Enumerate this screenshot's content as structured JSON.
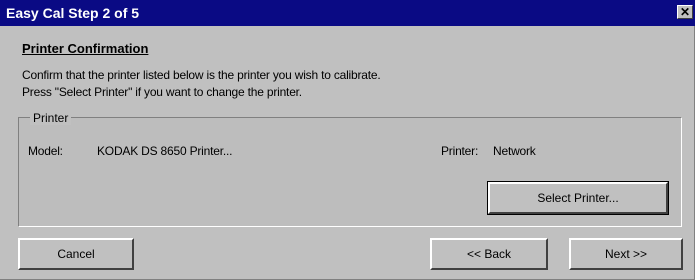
{
  "window": {
    "title": "Easy Cal Step 2 of 5",
    "close_glyph": "✕"
  },
  "main": {
    "heading": "Printer Confirmation",
    "instruction_line1": "Confirm that the printer listed below is the printer you wish to calibrate.",
    "instruction_line2": "Press \"Select Printer\" if you want to change the printer."
  },
  "printer_group": {
    "label": "Printer",
    "model_label": "Model:",
    "model_value": "KODAK DS 8650 Printer...",
    "printer_label": "Printer:",
    "printer_value": "Network",
    "select_button": "Select Printer..."
  },
  "footer": {
    "cancel": "Cancel",
    "back": "<< Back",
    "next": "Next >>"
  }
}
